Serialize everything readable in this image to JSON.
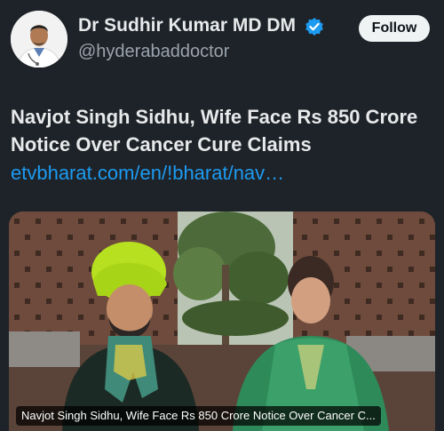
{
  "author": {
    "name": "Dr Sudhir Kumar MD DM",
    "handle": "@hyderabaddoctor",
    "verified": true
  },
  "actions": {
    "follow_label": "Follow"
  },
  "post": {
    "text": "Navjot Singh Sidhu, Wife Face Rs 850 Crore Notice Over Cancer Cure Claims",
    "link_text": "etvbharat.com/en/!bharat/nav…"
  },
  "card": {
    "caption": "Navjot Singh Sidhu, Wife Face Rs 850 Crore Notice Over Cancer C..."
  },
  "colors": {
    "background": "#1e2329",
    "link": "#1d9bf0",
    "verified_badge": "#1d9bf0",
    "follow_button": "#eff3f4"
  },
  "icons": {
    "verified": "verified-badge-icon"
  }
}
